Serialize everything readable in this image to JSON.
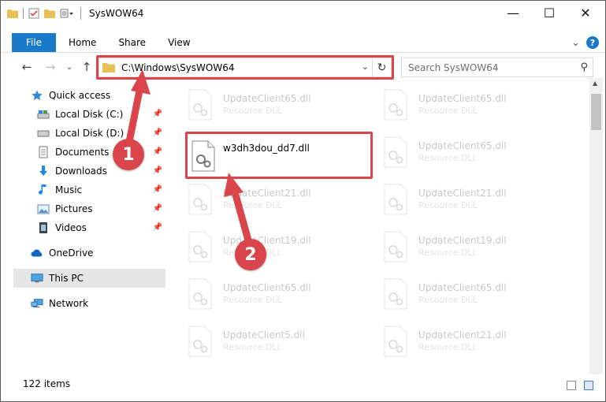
{
  "window": {
    "title": "SysWOW64",
    "minimize": "—",
    "maximize": "☐",
    "close": "✕"
  },
  "ribbon": {
    "tabs": [
      "File",
      "Home",
      "Share",
      "View"
    ],
    "expand_glyph": "⌄",
    "help_glyph": "?"
  },
  "nav": {
    "back_glyph": "←",
    "forward_glyph": "→",
    "recent_glyph": "⌄",
    "up_glyph": "↑",
    "address": "C:\\Windows\\SysWOW64",
    "search_placeholder": "Search SysWOW64"
  },
  "sidebar": {
    "items": [
      {
        "label": "Quick access",
        "icon": "star-icon",
        "pinned": false
      },
      {
        "label": "Local Disk (C:)",
        "icon": "drive-icon",
        "pinned": true
      },
      {
        "label": "Local Disk (D:)",
        "icon": "drive-icon",
        "pinned": true
      },
      {
        "label": "Documents",
        "icon": "documents-icon",
        "pinned": true
      },
      {
        "label": "Downloads",
        "icon": "download-icon",
        "pinned": true
      },
      {
        "label": "Music",
        "icon": "music-icon",
        "pinned": true
      },
      {
        "label": "Pictures",
        "icon": "pictures-icon",
        "pinned": true
      },
      {
        "label": "Videos",
        "icon": "videos-icon",
        "pinned": true
      },
      {
        "label": "OneDrive",
        "icon": "cloud-icon",
        "pinned": false
      },
      {
        "label": "This PC",
        "icon": "computer-icon",
        "pinned": false,
        "selected": true
      },
      {
        "label": "Network",
        "icon": "network-icon",
        "pinned": false
      }
    ]
  },
  "files": {
    "highlighted": {
      "name": "w3dh3dou_dd7.dll",
      "type": ""
    },
    "left_column": [
      {
        "name": "UpdateClient65.dll",
        "type": "Resource DLL"
      },
      {
        "name": "UpdateClient21.dll",
        "type": "Resource DLL"
      },
      {
        "name": "UpdateClient19.dll",
        "type": "Resource DLL"
      },
      {
        "name": "UpdateClient65.dll",
        "type": "Resource DLL"
      },
      {
        "name": "UpdateClient5.dll",
        "type": "Resource DLL"
      }
    ],
    "right_column": [
      {
        "name": "UpdateClient65.dll",
        "type": "Resource DLL"
      },
      {
        "name": "UpdateClient65.dll",
        "type": "Resource DLL"
      },
      {
        "name": "UpdateClient21.dll",
        "type": "Resource DLL"
      },
      {
        "name": "UpdateClient19.dll",
        "type": "Resource DLL"
      },
      {
        "name": "UpdateClient65.dll",
        "type": "Resource DLL"
      },
      {
        "name": "UpdateClient21.dll",
        "type": "Resource DLL"
      }
    ]
  },
  "annotations": {
    "step1": "1",
    "step2": "2",
    "color": "#d9454a"
  },
  "status": {
    "item_count": "122 items"
  },
  "colors": {
    "accent": "#1979ca",
    "selection": "#e5e5e5",
    "highlight": "#d9454a"
  }
}
